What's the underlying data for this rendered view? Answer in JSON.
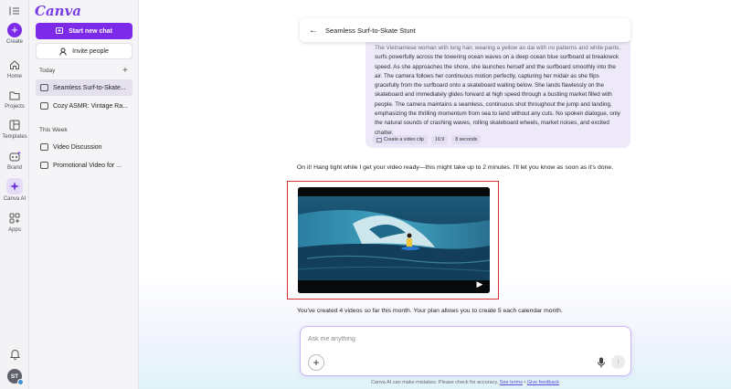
{
  "rail": {
    "create": "Create",
    "home": "Home",
    "projects": "Projects",
    "templates": "Templates",
    "brand": "Brand",
    "canva_ai": "Canva AI",
    "apps": "Apps",
    "avatar_initials": "ST"
  },
  "panel": {
    "logo": "Canva",
    "new_chat": "Start new chat",
    "invite": "Invite people",
    "today_label": "Today",
    "this_week_label": "This Week",
    "today_items": [
      "Seamless Surf-to-Skate...",
      "Cozy ASMR: Vintage Ra..."
    ],
    "week_items": [
      "Video Discussion",
      "Promotional Video for ..."
    ]
  },
  "header": {
    "title": "Seamless Surf-to-Skate Stunt"
  },
  "prompt": {
    "text": "The Vietnamese woman with long hair, wearing a yellow ao dai with no patterns and white pants, surfs powerfully across the towering ocean waves on a deep ocean blue surfboard at breakneck speed. As she approaches the shore, she launches herself and the surfboard smoothly into the air. The camera follows her continuous motion perfectly, capturing her midair as she flips gracefully from the surfboard onto a skateboard waiting below. She lands flawlessly on the skateboard and immediately glides forward at high speed through a bustling market filled with people. The camera maintains a seamless, continuous shot throughout the jump and landing, emphasizing the thrilling momentum from sea to land without any cuts. No spoken dialogue, only the natural sounds of crashing waves, rolling skateboard wheels, market noises, and excited chatter.",
    "tags": [
      "Create a video clip",
      "16:9",
      "8 seconds"
    ]
  },
  "response": {
    "reply": "On it! Hang tight while I get your video ready—this might take up to 2 minutes. I'll let you know as soon as it's done.",
    "note": "You've created 4 videos so far this month. Your plan allows you to create 5 each calendar month."
  },
  "composer": {
    "placeholder": "Ask me anything",
    "value": ""
  },
  "footer": {
    "text": "Canva AI can make mistakes. Please check for accuracy.",
    "terms": "See terms",
    "sep": "•",
    "feedback": "Give feedback"
  },
  "colors": {
    "brand": "#7d2ae8",
    "highlight_frame": "#d63131"
  }
}
